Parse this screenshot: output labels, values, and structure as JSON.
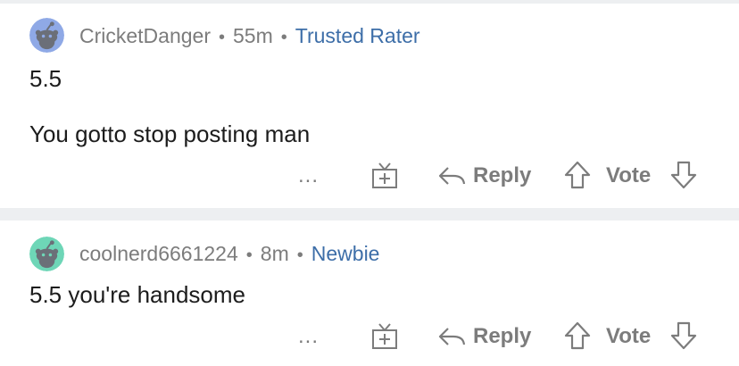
{
  "comments": [
    {
      "username": "CricketDanger",
      "time": "55m",
      "flair": "Trusted Rater",
      "avatar_color": "#8fa9e6",
      "body": [
        "5.5",
        "You gotto stop posting man"
      ],
      "actions": {
        "more": "...",
        "reply": "Reply",
        "vote": "Vote"
      }
    },
    {
      "username": "coolnerd6661224",
      "time": "8m",
      "flair": "Newbie",
      "avatar_color": "#6ed6b7",
      "body": [
        "5.5 you're handsome"
      ],
      "actions": {
        "more": "...",
        "reply": "Reply",
        "vote": "Vote"
      }
    }
  ],
  "separator": "•",
  "colors": {
    "meta": "#7c7c7c",
    "flair": "#3d6ea8",
    "text": "#1c1c1c",
    "divider": "#edeff1"
  },
  "icons": [
    "snoo-avatar-icon",
    "more-options-icon",
    "gift-icon",
    "reply-arrow-icon",
    "upvote-arrow-icon",
    "downvote-arrow-icon"
  ]
}
